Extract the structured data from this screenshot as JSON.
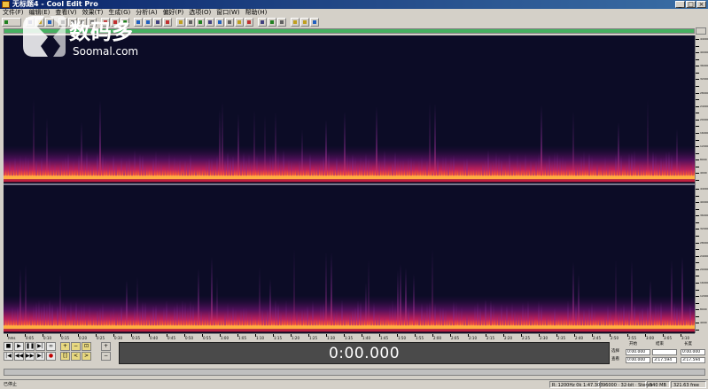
{
  "window": {
    "title": "无标题4 - Cool Edit Pro"
  },
  "menu": [
    "文件(F)",
    "编辑(E)",
    "查看(V)",
    "效果(T)",
    "生成(G)",
    "分析(A)",
    "偏好(P)",
    "选项(O)",
    "窗口(W)",
    "帮助(H)"
  ],
  "watermark": {
    "cn": "数码多",
    "en": "Soomal.com"
  },
  "time_display": "0:00.000",
  "frequency_ruler": [
    "44000",
    "42000",
    "40000",
    "38000",
    "36000",
    "34000",
    "32000",
    "30000",
    "28000",
    "26000",
    "24000",
    "22000",
    "20000",
    "18000",
    "16000",
    "14000",
    "12000",
    "10000",
    "8000",
    "6000",
    "4000",
    "2000"
  ],
  "time_ruler": [
    "hms",
    "0:05",
    "0:10",
    "0:15",
    "0:20",
    "0:25",
    "0:30",
    "0:35",
    "0:40",
    "0:45",
    "0:50",
    "0:55",
    "1:00",
    "1:05",
    "1:10",
    "1:15",
    "1:20",
    "1:25",
    "1:30",
    "1:35",
    "1:40",
    "1:45",
    "1:50",
    "1:55",
    "2:00",
    "2:05",
    "2:10",
    "2:15",
    "2:20",
    "2:25",
    "2:30",
    "2:35",
    "2:40",
    "2:45",
    "2:50",
    "2:55",
    "3:00",
    "3:05",
    "3:10"
  ],
  "selection": {
    "headers": [
      "开始",
      "结束",
      "长度"
    ],
    "rows": [
      {
        "label": "选择",
        "start": "0:00.000",
        "end": "",
        "length": "0:00.000"
      },
      {
        "label": "查看",
        "start": "0:00.000",
        "end": "3:17.594",
        "length": "3:17.594"
      }
    ]
  },
  "status": {
    "left": "已停止",
    "freq": "R: 1200Hz 0k  1:47.303",
    "format": "96000 · 32-bit · Stereo",
    "size": "540 MB",
    "free": "321.63 free"
  },
  "colors": {
    "background": "#0c0c26",
    "accent": "#46b060",
    "display": "#4a4a4a"
  }
}
